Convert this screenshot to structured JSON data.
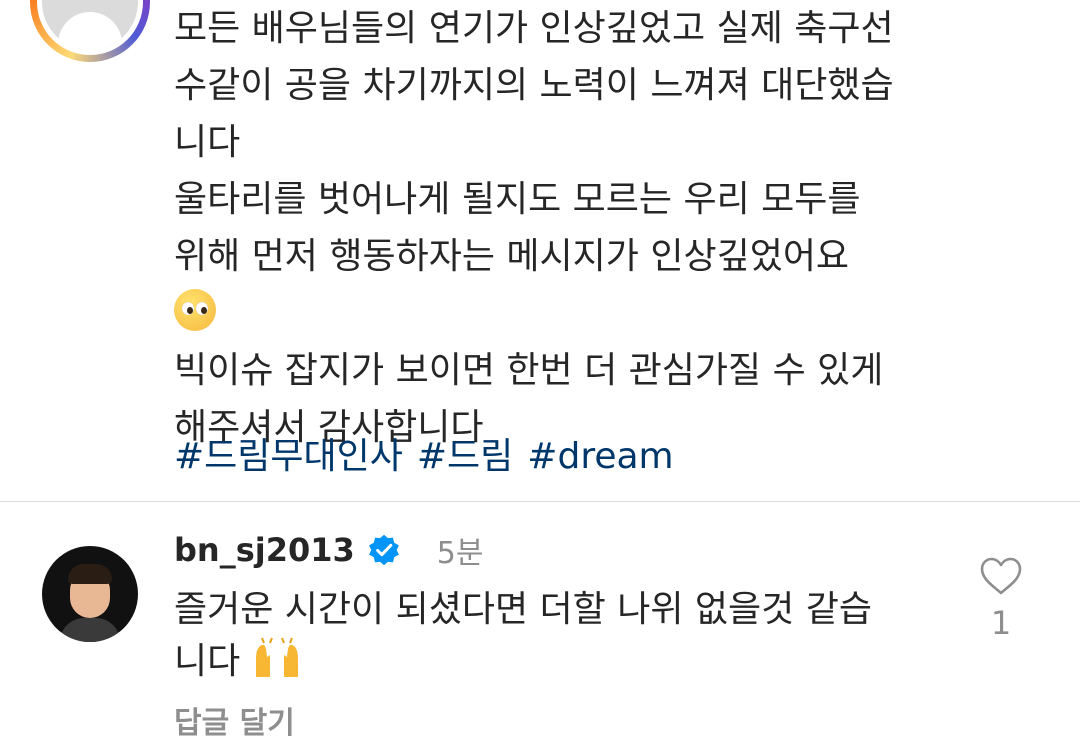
{
  "post": {
    "lines": [
      "모든 배우님들의 연기가 인상깊었고 실제 축구선",
      "수같이 공을 차기까지의 노력이 느껴져 대단했습",
      "니다",
      "울타리를 벗어나게 될지도 모르는 우리 모두를",
      "위해 먼저 행동하자는 메시지가 인상깊었어요",
      "빅이슈 잡지가 보이면 한번 더 관심가질 수 있게",
      "해주셔서 감사합니다"
    ],
    "emoji": "pleading-face-emoji",
    "hashtags": [
      "#드림무대인사",
      "#드림",
      "#dream"
    ]
  },
  "reply": {
    "username": "bn_sj2013",
    "time": "5분",
    "lines": [
      "즐거운 시간이 되셨다면 더할 나위 없을것 같습",
      "니다"
    ],
    "emoji": "raising-hands-emoji",
    "reply_label": "답글 달기",
    "like_count": "1"
  },
  "colors": {
    "hashtag": "#00376b",
    "verified": "#0095f6",
    "muted": "#8e8e8e"
  }
}
